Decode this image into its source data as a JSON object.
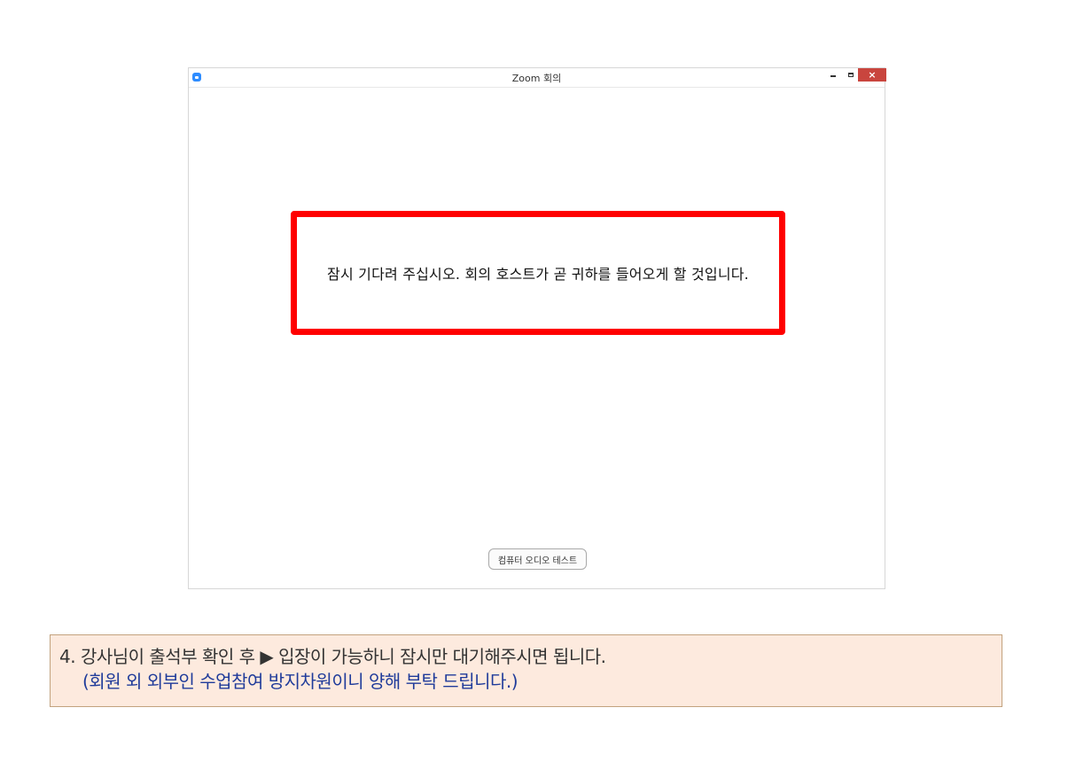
{
  "window": {
    "title": "Zoom 회의",
    "controls": {
      "minimize_icon": "minimize-icon",
      "maximize_icon": "maximize-icon",
      "close_label": "×"
    }
  },
  "main": {
    "waiting_message": "잠시 기다려 주십시오. 회의 호스트가 곧 귀하를 들어오게 할 것입니다.",
    "audio_test_button": "컴퓨터 오디오 테스트"
  },
  "note": {
    "line1": "4. 강사님이 출석부 확인 후 ▶ 입장이 가능하니 잠시만 대기해주시면 됩니다.",
    "line2": "(회원 외 외부인 수업참여 방지차원이니 양해 부탁 드립니다.)"
  },
  "colors": {
    "highlight": "#ff0000",
    "close_button": "#c9453e",
    "note_background": "#fdeade",
    "note_line2_text": "#1f3b9a",
    "zoom_brand": "#2d8cff"
  }
}
